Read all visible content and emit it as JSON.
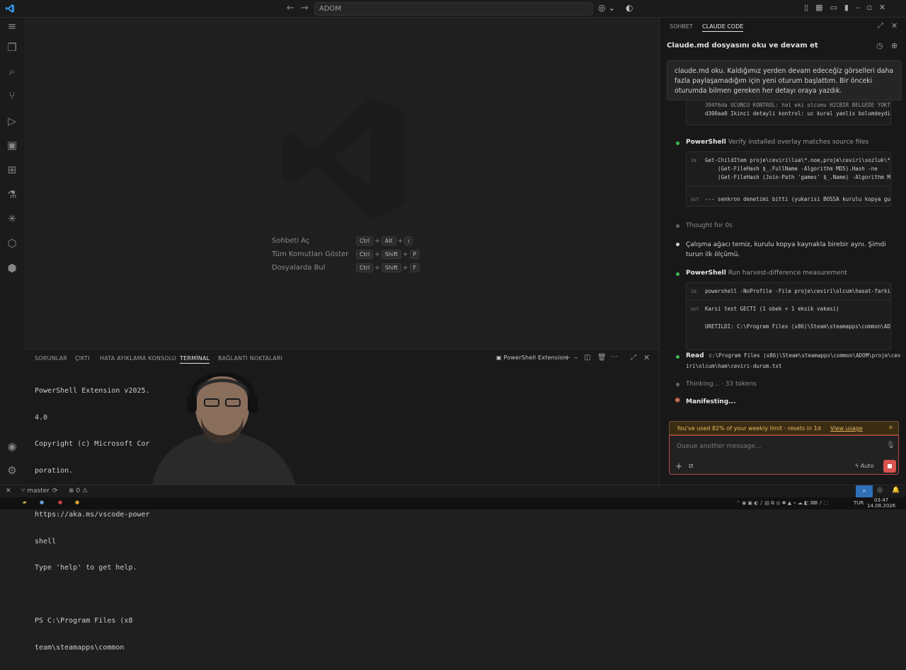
{
  "titlebar": {
    "search_text": "ADOM",
    "nav_back": "←",
    "nav_forward": "→"
  },
  "editor": {
    "shortcuts": [
      {
        "label": "Sohbeti Aç",
        "keys": [
          "Ctrl",
          "Alt",
          "ı"
        ]
      },
      {
        "label": "Tüm Komutları Göster",
        "keys": [
          "Ctrl",
          "Shift",
          "P"
        ]
      },
      {
        "label": "Dosyalarda Bul",
        "keys": [
          "Ctrl",
          "Shift",
          "F"
        ]
      }
    ]
  },
  "panel": {
    "tabs": [
      "SORUNLAR",
      "ÇIKTI",
      "HATA AYIKLAMA KONSOLU",
      "TERMİNAL",
      "BAĞLANTI NOKTALARI"
    ],
    "active_tab": "TERMİNAL",
    "terminal_name": "PowerShell Extension",
    "terminal_lines": [
      "PowerShell Extension v2025.",
      "4.0",
      "Copyright (c) Microsoft Cor",
      "poration.",
      "",
      "https://aka.ms/vscode-power",
      "shell",
      "Type 'help' to get help.",
      "",
      "PS C:\\Program Files (x8",
      "team\\steamapps\\common"
    ]
  },
  "sidebar": {
    "tabs": [
      "SOHBET",
      "CLAUDE CODE"
    ],
    "active_tab": "CLAUDE CODE",
    "chat_title": "Claude.md dosyasını oku ve devam et",
    "user_message": "claude.md oku. Kaldığımız yerden devam edeceğiz görselleri daha fazla paylaşamadığım için yeni oturum başlattım. Bir önceki oturumda bilmen gereken her detayı oraya yazdık.",
    "top_code_lines": [
      "394f6da UCUNCU KONTROL: hal eki olcumu HICBIR BELGEDE YOKT",
      "d300aa0 Ikinci detayli kontrol: uc kural yanlis bolumdeydi"
    ],
    "step1": {
      "tool": "PowerShell",
      "desc": "Verify installed overlay matches source files",
      "in_label": "IN",
      "in_lines": [
        "Get-ChildItem proje\\ceviri\\lua\\*.noe,proje\\ceviri\\sozluk\\*.",
        "    (Get-FileHash $_.FullName -Algorithm MD5).Hash -ne",
        "    (Get-FileHash (Join-Path 'games' $_.Name) -Algorithm MD5)"
      ],
      "out_label": "OUT",
      "out_lines": [
        "--- senkron denetimi bitti (yukarisi BOSSA kurulu kopya gu"
      ]
    },
    "thought": "Thought for 0s",
    "assistant_text": "Çalışma ağacı temiz, kurulu kopya kaynakla birebir aynı. Şimdi turun ilk ölçümü.",
    "step2": {
      "tool": "PowerShell",
      "desc": "Run harvest-difference measurement",
      "in_label": "IN",
      "in_lines": [
        "powershell -NoProfile -File proje\\ceviri\\olcum\\hasat-farki."
      ],
      "out_label": "OUT",
      "out_lines": [
        "Karsi test GECTI (1 obek + 1 eksik vakasi)",
        "",
        "URETILDI: C:\\Program Files (x86)\\Steam\\steamapps\\common\\ADO"
      ]
    },
    "read": {
      "tool": "Read",
      "path_line1": "c:\\Program Files (x86)\\Steam\\steamapps\\common\\ADOM\\proje\\cev",
      "path_line2": "iri\\olcum\\ham\\ceviri-durum.txt"
    },
    "thinking": "Thinking... · 33 tokens",
    "manifesting": "Manifesting...",
    "limit_text": "You've used 82% of your weekly limit · resets in 1d",
    "limit_link": "View usage",
    "input_placeholder": "Queue another message...",
    "mode_label": "Auto",
    "colors": {
      "accent_limit": "#e8b85c",
      "stop": "#d9534f",
      "bullet_green": "#3fb950",
      "bullet_orange": "#e07b53"
    }
  },
  "statusbar": {
    "branch": "master",
    "errors": "0",
    "warnings": "0"
  },
  "taskbar": {
    "lang": "TUR",
    "time": "03:47",
    "date": "14.08.2026"
  }
}
